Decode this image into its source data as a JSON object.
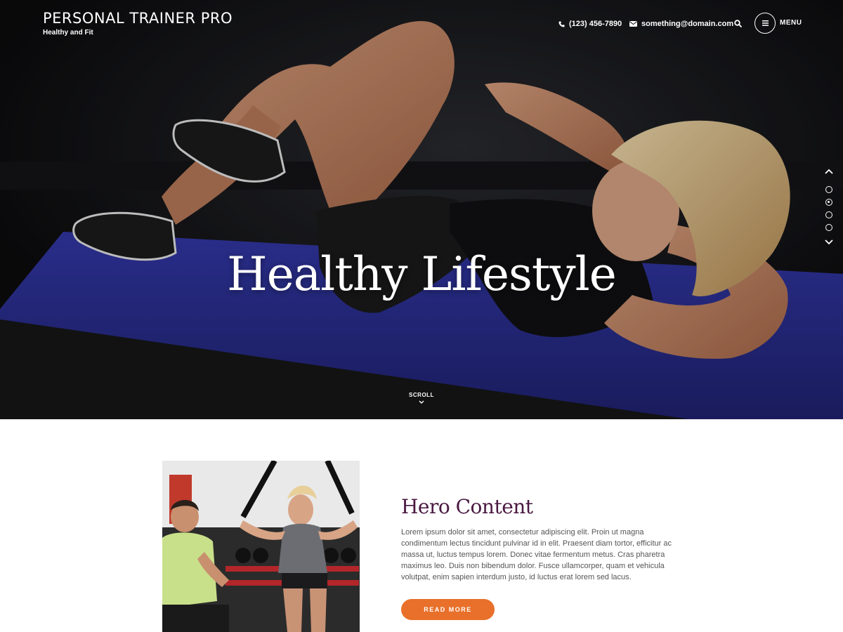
{
  "header": {
    "site_title": "PERSONAL TRAINER PRO",
    "tagline": "Healthy and Fit",
    "phone": "(123) 456-7890",
    "email": "something@domain.com",
    "menu_label": "MENU",
    "icons": [
      "phone-icon",
      "envelope-icon",
      "search-icon",
      "hamburger-icon"
    ]
  },
  "hero": {
    "heading": "Healthy Lifestyle",
    "scroll_label": "SCROLL",
    "slider": {
      "total": 4,
      "active": 2
    }
  },
  "intro": {
    "title": "Hero Content",
    "body": "Lorem ipsum dolor sit amet, consectetur adipiscing elit. Proin ut magna condimentum lectus tincidunt pulvinar id in elit. Praesent diam tortor, efficitur ac massa ut, luctus tempus lorem. Donec vitae fermentum metus. Cras pharetra maximus leo. Duis non bibendum dolor. Fusce ullamcorper, quam et vehicula volutpat, enim sapien interdum justo, id luctus erat lorem sed lacus.",
    "button_label": "READ MORE"
  },
  "colors": {
    "accent": "#e8702a",
    "title": "#4a1942",
    "hero_bg": "#0d0d0f",
    "mat": "#2b2f8f"
  }
}
